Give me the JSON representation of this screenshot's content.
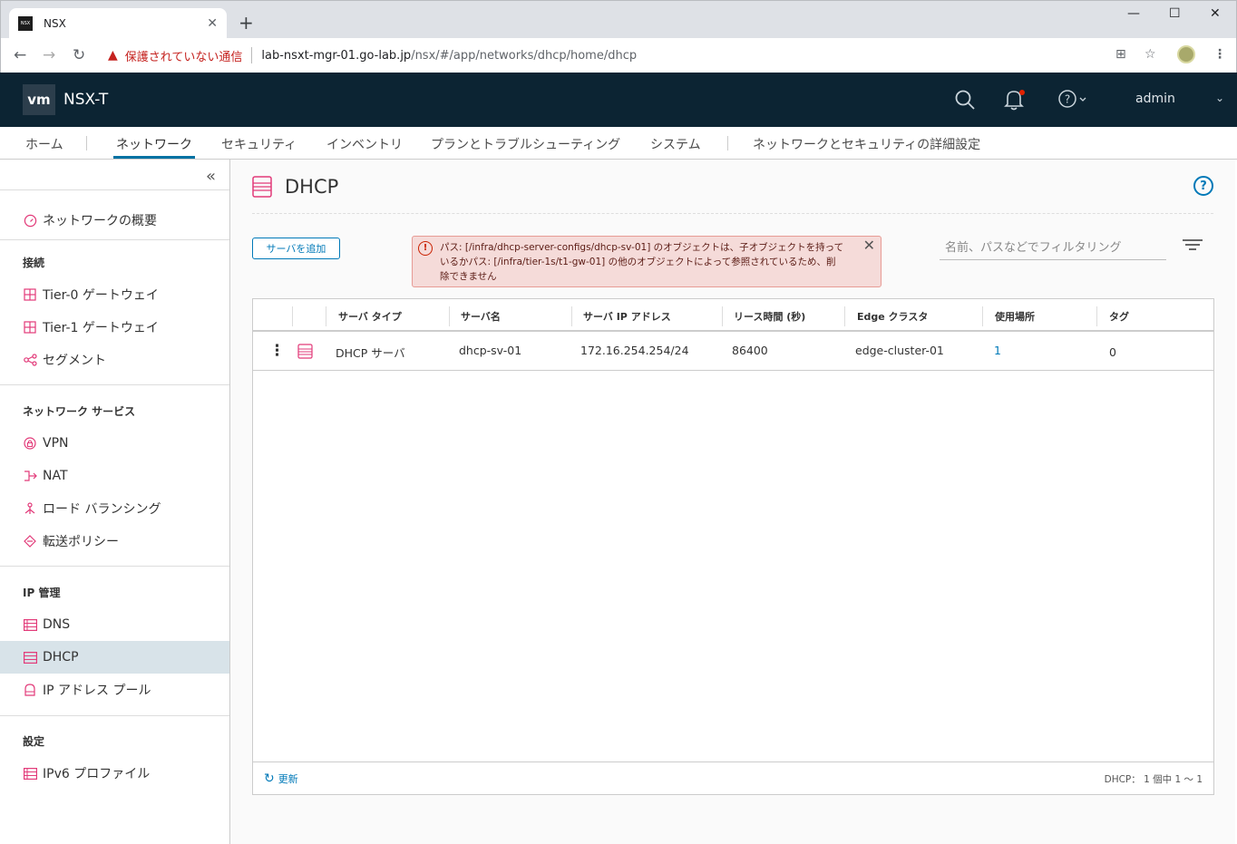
{
  "browser": {
    "tab_title": "NSX",
    "favicon_text": "NSX",
    "security_warning": "保護されていない通信",
    "url_host": "lab-nsxt-mgr-01.go-lab.jp",
    "url_path": "/nsx/#/app/networks/dhcp/home/dhcp"
  },
  "header": {
    "logo": "vm",
    "app_name": "NSX-T",
    "user": "admin"
  },
  "topnav": {
    "items": [
      "ホーム",
      "ネットワーク",
      "セキュリティ",
      "インベントリ",
      "プランとトラブルシューティング",
      "システム",
      "ネットワークとセキュリティの詳細設定"
    ],
    "active_index": 1
  },
  "sidebar": {
    "overview": "ネットワークの概要",
    "sections": [
      {
        "heading": "接続",
        "items": [
          "Tier-0 ゲートウェイ",
          "Tier-1 ゲートウェイ",
          "セグメント"
        ]
      },
      {
        "heading": "ネットワーク サービス",
        "items": [
          "VPN",
          "NAT",
          "ロード バランシング",
          "転送ポリシー"
        ]
      },
      {
        "heading": "IP 管理",
        "items": [
          "DNS",
          "DHCP",
          "IP アドレス プール"
        ]
      },
      {
        "heading": "設定",
        "items": [
          "IPv6 プロファイル"
        ]
      }
    ],
    "selected": "DHCP"
  },
  "main": {
    "title": "DHCP",
    "add_button": "サーバを追加",
    "alert_text": "パス: [/infra/dhcp-server-configs/dhcp-sv-01] のオブジェクトは、子オブジェクトを持っているかパス: [/infra/tier-1s/t1-gw-01] の他のオブジェクトによって参照されているため、削除できません",
    "filter_placeholder": "名前、パスなどでフィルタリング",
    "grid": {
      "columns": [
        "サーバ タイプ",
        "サーバ名",
        "サーバ IP アドレス",
        "リース時間 (秒)",
        "Edge クラスタ",
        "使用場所",
        "タグ"
      ],
      "rows": [
        {
          "type": "DHCP サーバ",
          "name": "dhcp-sv-01",
          "ip": "172.16.254.254/24",
          "lease": "86400",
          "edge_cluster": "edge-cluster-01",
          "usage": "1",
          "tags": "0"
        }
      ],
      "refresh_label": "更新",
      "footer_count": "DHCP： 1 個中 1 ～ 1"
    }
  },
  "colors": {
    "header_bg": "#0c2433",
    "accent": "#0079b8",
    "icon_pink": "#e23a79",
    "alert_bg": "#f5dbd9",
    "selected_bg": "#d8e3e9"
  }
}
